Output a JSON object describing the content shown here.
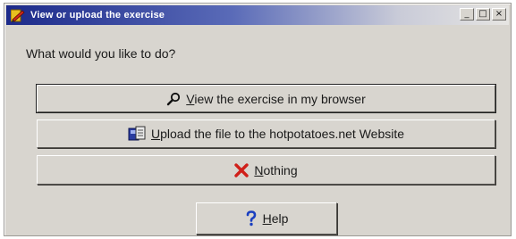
{
  "window": {
    "title": "View or upload the exercise",
    "controls": {
      "minimize": "_",
      "maximize": "□",
      "close": "×"
    }
  },
  "prompt": "What would you like to do?",
  "buttons": {
    "view": {
      "accel": "V",
      "rest": "iew the exercise in my browser",
      "icon": "magnifier-icon"
    },
    "upload": {
      "accel": "U",
      "rest": "pload the file to the hotpotatoes.net Website",
      "icon": "upload-icon"
    },
    "nothing": {
      "accel": "N",
      "rest": "othing",
      "icon": "red-x-icon"
    },
    "help": {
      "accel": "H",
      "rest": "elp",
      "icon": "question-mark-icon"
    }
  },
  "colors": {
    "title_start": "#1c2a8a",
    "dialog_bg": "#d8d5cf",
    "cancel_red": "#d0201a",
    "help_blue": "#1a3fc0"
  }
}
